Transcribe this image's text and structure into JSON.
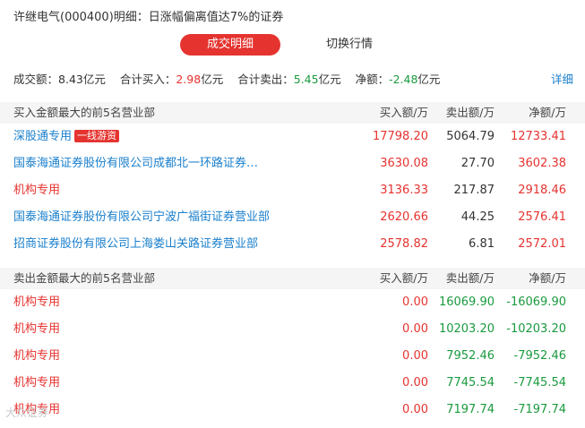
{
  "title": "许继电气(000400)明细：日涨幅偏离值达7%的证券",
  "tabs": {
    "active": "成交明细",
    "other": "切换行情"
  },
  "summary": {
    "volume_label": "成交额：",
    "volume_value": "8.43亿元",
    "buy_label": "合计买入：",
    "buy_value": "2.98",
    "buy_unit": "亿元",
    "sell_label": "合计卖出：",
    "sell_value": "5.45",
    "sell_unit": "亿元",
    "net_label": "净额：",
    "net_value": "-2.48",
    "net_unit": "亿元",
    "detail_link": "详细"
  },
  "buy_section": {
    "header": "买入金额最大的前5名营业部",
    "col_buy": "买入额/万",
    "col_sell": "卖出额/万",
    "col_net": "净额/万",
    "rows": [
      {
        "name": "深股通专用",
        "badge": "一线游资",
        "buy": "17798.20",
        "sell": "5064.79",
        "net": "12733.41"
      },
      {
        "name": "国泰海通证券股份有限公司成都北一环路证券…",
        "buy": "3630.08",
        "sell": "27.70",
        "net": "3602.38"
      },
      {
        "name": "机构专用",
        "buy": "3136.33",
        "sell": "217.87",
        "net": "2918.46"
      },
      {
        "name": "国泰海通证券股份有限公司宁波广福街证券营业部",
        "buy": "2620.66",
        "sell": "44.25",
        "net": "2576.41"
      },
      {
        "name": "招商证券股份有限公司上海娄山关路证券营业部",
        "buy": "2578.82",
        "sell": "6.81",
        "net": "2572.01"
      }
    ]
  },
  "sell_section": {
    "header": "卖出金额最大的前5名营业部",
    "col_buy": "买入额/万",
    "col_sell": "卖出额/万",
    "col_net": "净额/万",
    "rows": [
      {
        "name": "机构专用",
        "buy": "0.00",
        "sell": "16069.90",
        "net": "-16069.90"
      },
      {
        "name": "机构专用",
        "buy": "0.00",
        "sell": "10203.20",
        "net": "-10203.20"
      },
      {
        "name": "机构专用",
        "buy": "0.00",
        "sell": "7952.46",
        "net": "-7952.46"
      },
      {
        "name": "机构专用",
        "buy": "0.00",
        "sell": "7745.54",
        "net": "-7745.54"
      },
      {
        "name": "机构专用",
        "buy": "0.00",
        "sell": "7197.74",
        "net": "-7197.74"
      }
    ]
  },
  "watermark": "大众证券"
}
